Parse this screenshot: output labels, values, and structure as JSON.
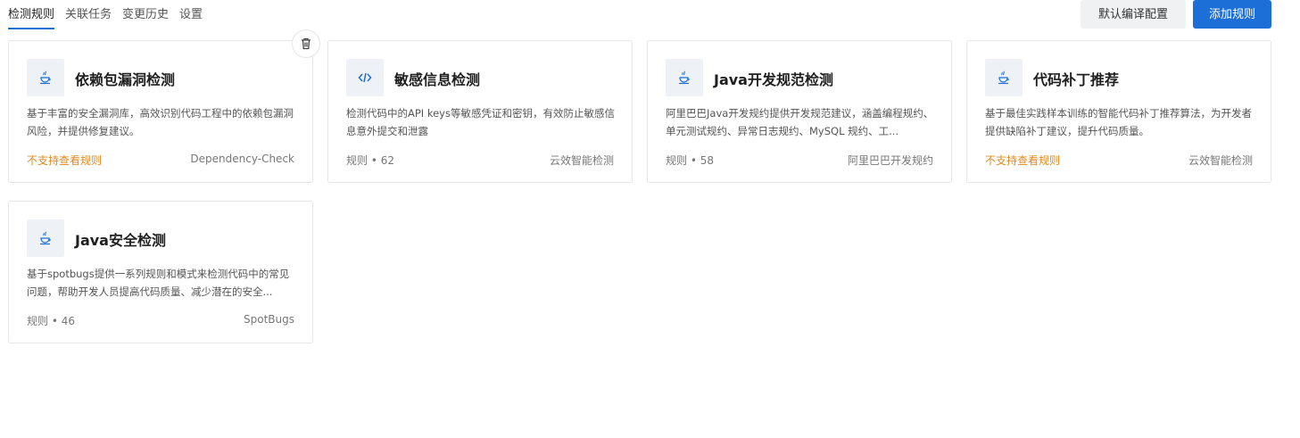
{
  "tabs": [
    {
      "label": "检测规则",
      "active": true
    },
    {
      "label": "关联任务",
      "active": false
    },
    {
      "label": "变更历史",
      "active": false
    },
    {
      "label": "设置",
      "active": false
    }
  ],
  "actions": {
    "default_config": "默认编译配置",
    "add_rule": "添加规则"
  },
  "colors": {
    "primary": "#1b6fd6",
    "warning": "#e08a1e",
    "icon": "#1b6fd6"
  },
  "cards": [
    {
      "icon": "java-cup-icon",
      "title": "依赖包漏洞检测",
      "desc": "基于丰富的安全漏洞库，高效识别代码工程中的依赖包漏洞风险，并提供修复建议。",
      "meta_left": "不支持查看规则",
      "meta_right": "Dependency-Check"
    },
    {
      "icon": "code-icon",
      "title": "敏感信息检测",
      "desc": "检测代码中的API keys等敏感凭证和密钥，有效防止敏感信息意外提交和泄露",
      "meta_left": "规则 • 62",
      "meta_right": "云效智能检测"
    },
    {
      "icon": "java-cup-icon",
      "title": "Java开发规范检测",
      "desc": "阿里巴巴Java开发规约提供开发规范建议，涵盖编程规约、单元测试规约、异常日志规约、MySQL 规约、工...",
      "meta_left": "规则 • 58",
      "meta_right": "阿里巴巴开发规约"
    },
    {
      "icon": "java-cup-icon",
      "title": "代码补丁推荐",
      "desc": "基于最佳实践样本训练的智能代码补丁推荐算法，为开发者提供缺陷补丁建议，提升代码质量。",
      "meta_left": "不支持查看规则",
      "meta_right": "云效智能检测"
    },
    {
      "icon": "java-cup-icon",
      "title": "Java安全检测",
      "desc": "基于spotbugs提供一系列规则和模式来检测代码中的常见问题，帮助开发人员提高代码质量、减少潜在的安全...",
      "meta_left": "规则 • 46",
      "meta_right": "SpotBugs"
    }
  ]
}
